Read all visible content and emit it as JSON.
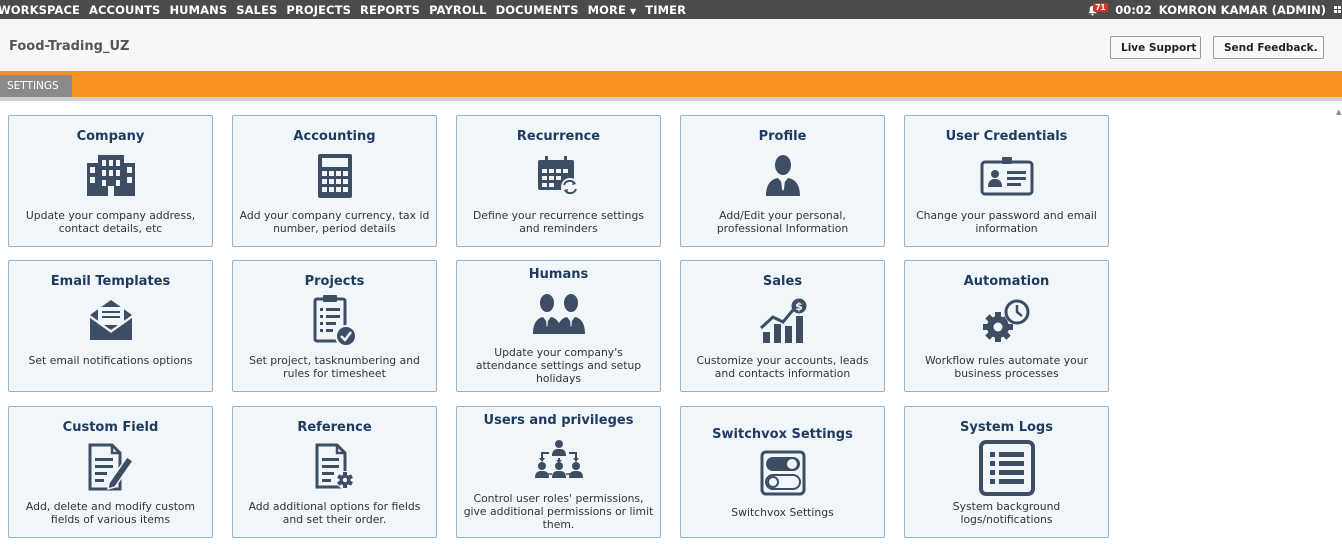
{
  "nav": {
    "items": [
      "WORKSPACE",
      "ACCOUNTS",
      "HUMANS",
      "SALES",
      "PROJECTS",
      "REPORTS",
      "PAYROLL",
      "DOCUMENTS",
      "MORE",
      "TIMER"
    ],
    "notification_count": "71",
    "timer": "00:02",
    "user": "KOMRON KAMAR (ADMIN)"
  },
  "header": {
    "company": "Food-Trading_UZ",
    "live_support": "Live Support",
    "send_feedback": "Send Feedback."
  },
  "breadcrumb": {
    "tab": "SETTINGS"
  },
  "tiles": [
    {
      "title": "Company",
      "icon": "building-icon",
      "desc": "Update your company address, contact details, etc"
    },
    {
      "title": "Accounting",
      "icon": "calculator-icon",
      "desc": "Add your company currency, tax id number, period details"
    },
    {
      "title": "Recurrence",
      "icon": "calendar-refresh-icon",
      "desc": "Define your recurrence settings and reminders"
    },
    {
      "title": "Profile",
      "icon": "user-icon",
      "desc": "Add/Edit your personal, professional Information"
    },
    {
      "title": "User Credentials",
      "icon": "id-card-icon",
      "desc": "Change your password and email information"
    },
    {
      "title": "Email Templates",
      "icon": "envelope-icon",
      "desc": "Set email notifications options"
    },
    {
      "title": "Projects",
      "icon": "clipboard-check-icon",
      "desc": "Set project, tasknumbering and rules for timesheet"
    },
    {
      "title": "Humans",
      "icon": "people-icon",
      "desc": "Update your company's attendance settings and setup holidays"
    },
    {
      "title": "Sales",
      "icon": "sales-chart-icon",
      "desc": "Customize your accounts, leads and contacts information"
    },
    {
      "title": "Automation",
      "icon": "gear-clock-icon",
      "desc": "Workflow rules automate your business processes"
    },
    {
      "title": "Custom Field",
      "icon": "document-edit-icon",
      "desc": "Add, delete and modify custom fields of various items"
    },
    {
      "title": "Reference",
      "icon": "document-gear-icon",
      "desc": "Add additional options for fields and set their order."
    },
    {
      "title": "Users and privileges",
      "icon": "user-network-icon",
      "desc": "Control user roles' permissions, give additional permissions or limit them."
    },
    {
      "title": "Switchvox Settings",
      "icon": "toggle-icon",
      "desc": "Switchvox Settings"
    },
    {
      "title": "System Logs",
      "icon": "list-icon",
      "desc": "System background logs/notifications"
    }
  ]
}
